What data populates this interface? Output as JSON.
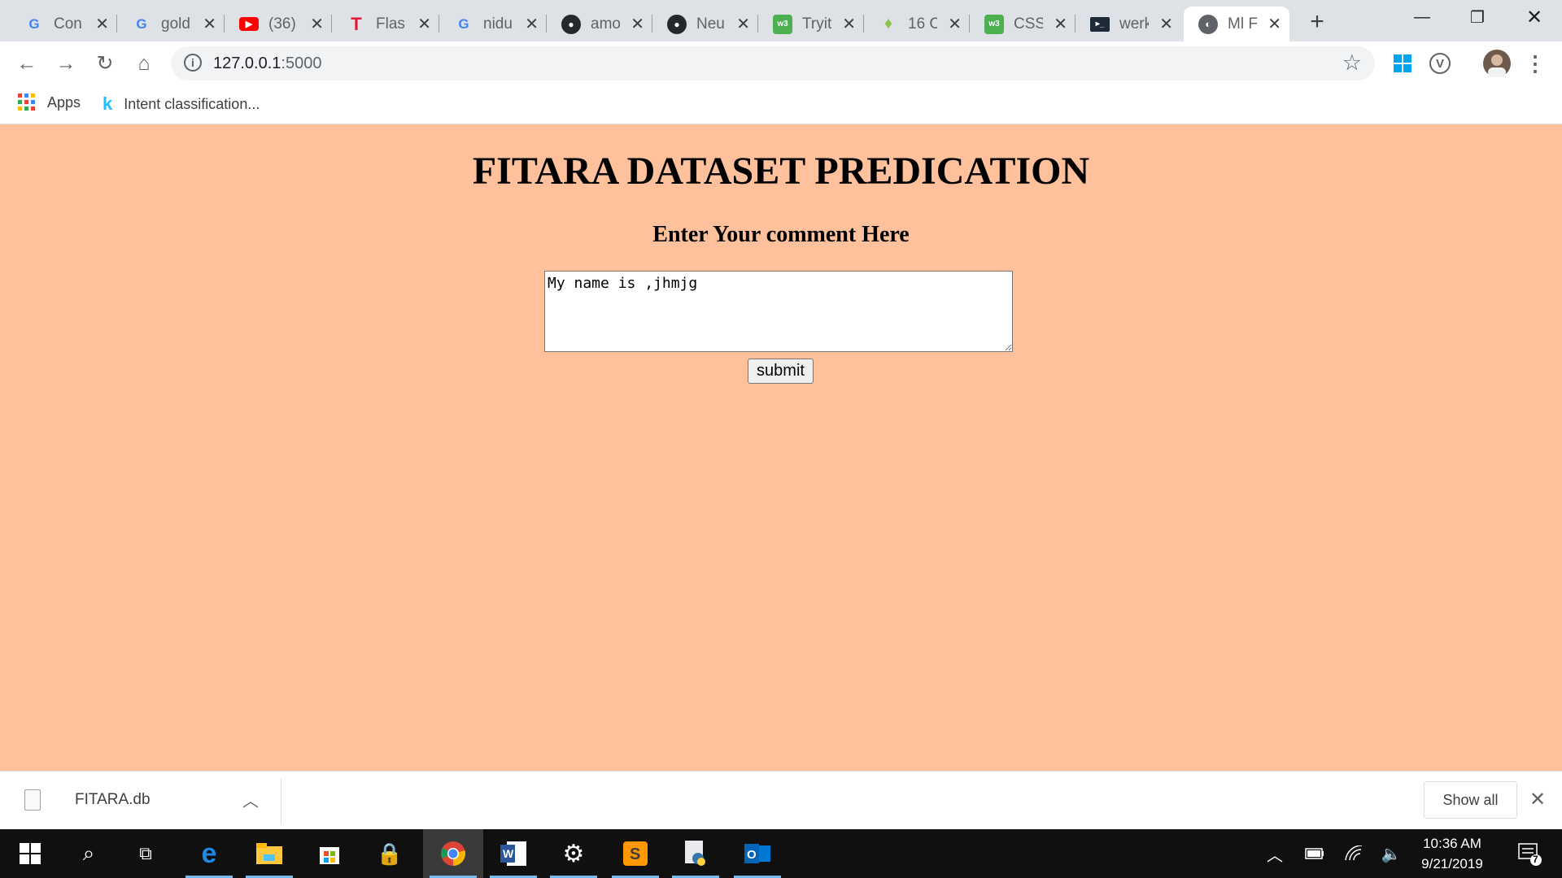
{
  "browser": {
    "tabs": [
      {
        "title": "Con",
        "favicon": "google-icon"
      },
      {
        "title": "gold",
        "favicon": "google-icon"
      },
      {
        "title": "(36)",
        "favicon": "youtube-icon"
      },
      {
        "title": "Flask",
        "favicon": "tesla-icon"
      },
      {
        "title": "nidu",
        "favicon": "google-icon"
      },
      {
        "title": "amo",
        "favicon": "github-icon"
      },
      {
        "title": "Neu",
        "favicon": "github-icon"
      },
      {
        "title": "Tryit",
        "favicon": "w3schools-icon"
      },
      {
        "title": "16 C",
        "favicon": "lightbulb-icon"
      },
      {
        "title": "CSS",
        "favicon": "w3schools-icon"
      },
      {
        "title": "werk",
        "favicon": "terminal-icon"
      },
      {
        "title": "Ml F",
        "favicon": "globe-icon"
      }
    ],
    "address": {
      "host": "127.0.0.1",
      "port": ":5000"
    },
    "bookmarks": {
      "apps": "Apps",
      "item1": "Intent classification..."
    }
  },
  "page": {
    "title": "FITARA DATASET PREDICATION",
    "subtitle": "Enter Your comment Here",
    "comment_value": "My name is ,jhmjg",
    "submit_label": "submit",
    "background_color": "#fec19c"
  },
  "download_bar": {
    "file_name": "FITARA.db",
    "show_all": "Show all"
  },
  "taskbar": {
    "time": "10:36 AM",
    "date": "9/21/2019",
    "notification_count": "7"
  }
}
